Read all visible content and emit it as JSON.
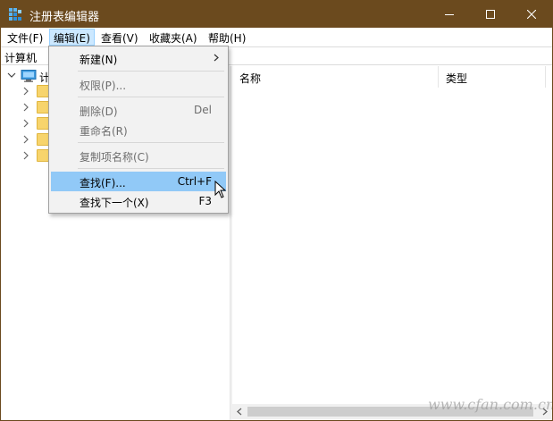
{
  "window": {
    "title": "注册表编辑器",
    "title_bar_color": "#6b4a1e"
  },
  "menubar": {
    "items": [
      "文件(F)",
      "编辑(E)",
      "查看(V)",
      "收藏夹(A)",
      "帮助(H)"
    ],
    "active_index": 1
  },
  "address": {
    "value": "计算机"
  },
  "tree": {
    "root_label": "计",
    "root_icon": "computer-icon",
    "child_count": 5
  },
  "list": {
    "columns": [
      "名称",
      "类型"
    ]
  },
  "edit_menu": {
    "new": {
      "label": "新建(N)"
    },
    "permissions": {
      "label": "权限(P)..."
    },
    "delete": {
      "label": "删除(D)",
      "shortcut": "Del"
    },
    "rename": {
      "label": "重命名(R)"
    },
    "copy_key_name": {
      "label": "复制项名称(C)"
    },
    "find": {
      "label": "查找(F)...",
      "shortcut": "Ctrl+F"
    },
    "find_next": {
      "label": "查找下一个(X)",
      "shortcut": "F3"
    },
    "highlight_color": "#91c9f7"
  },
  "watermark": {
    "text": "www.cfan.com.cn"
  }
}
